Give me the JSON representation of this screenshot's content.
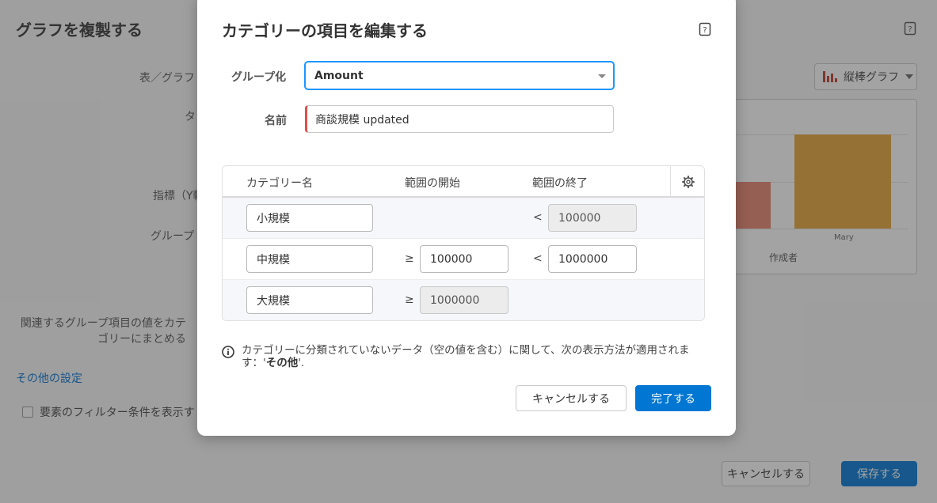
{
  "background": {
    "title": "グラフを複製する",
    "labels": {
      "table_graph": "表／グラフ",
      "tab": "タ",
      "metric": "指標（Y軸",
      "group": "グループ",
      "combine_line1": "関連するグループ項目の値をカテ",
      "combine_line2": "ゴリーにまとめる"
    },
    "chart_type_select": {
      "value": "縦棒グラフ"
    },
    "chart": {
      "x_tick_label": "Mary",
      "x_axis_title": "作成者",
      "bar_colors": [
        "#e8846e",
        "#e6a43a"
      ]
    },
    "more_settings_link": "その他の設定",
    "filter_checkbox_label": "要素のフィルター条件を表示す",
    "cancel_button": "キャンセルする",
    "save_button": "保存する"
  },
  "modal": {
    "title": "カテゴリーの項目を編集する",
    "group_label": "グループ化",
    "group_value": "Amount",
    "name_label": "名前",
    "name_value": "商談規模 updated",
    "table": {
      "headers": [
        "カテゴリー名",
        "範囲の開始",
        "範囲の終了"
      ],
      "rows": [
        {
          "name": "小規模",
          "start_op": "",
          "start": "",
          "end_op": "<",
          "end": "100000"
        },
        {
          "name": "中規模",
          "start_op": "≥",
          "start": "100000",
          "end_op": "<",
          "end": "1000000"
        },
        {
          "name": "大規模",
          "start_op": "≥",
          "start": "1000000",
          "end_op": "",
          "end": ""
        }
      ]
    },
    "info_text_prefix": "カテゴリーに分類されていないデータ（空の値を含む）に関して、次の表示方法が適用されます：'",
    "info_text_bold": "その他",
    "info_text_suffix": "'.",
    "cancel_button": "キャンセルする",
    "done_button": "完了する"
  }
}
